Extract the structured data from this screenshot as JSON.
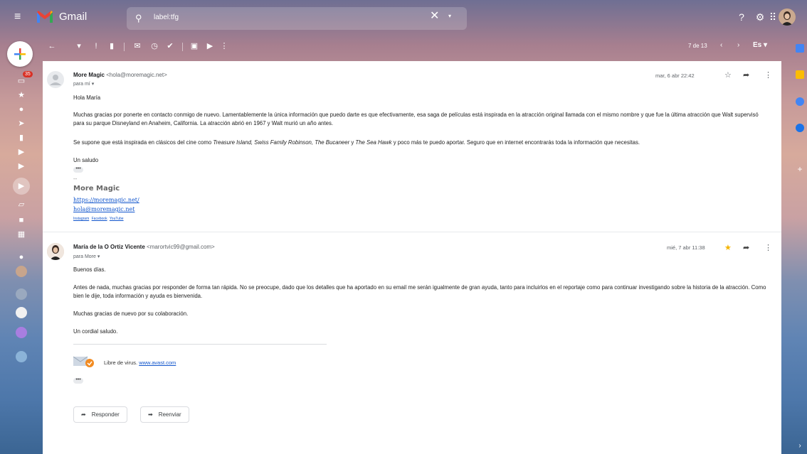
{
  "app": {
    "name": "Gmail",
    "search_query": "label:tfg",
    "unread_badge": "35",
    "pager": "7 de 13",
    "lang": "Es"
  },
  "messages": [
    {
      "sender_name": "More Magic",
      "sender_email": "<hola@moremagic.net>",
      "recipient": "para mí",
      "date": "mar, 6 abr 22:42",
      "greeting": "Hola María",
      "paragraph1": "Muchas gracias por ponerte en contacto conmigo de nuevo. Lamentablemente la única información que puedo darte es que efectivamente, esa saga de películas está inspirada en la atracción original llamada con el mismo nombre y que fue la última atracción que Walt supervisó para su parque Disneyland en Anaheim, California. La atracción abrió en 1967 y Walt murió un año antes.",
      "paragraph2_pre": "Se supone que está inspirada en clásicos del cine como ",
      "paragraph2_em1": "Treasure Island, Swiss Family Robinson, The Bucaneer",
      "paragraph2_mid": " y ",
      "paragraph2_em2": "The Sea Hawk",
      "paragraph2_post": " y poco más te puedo aportar. Seguro que en internet encontrarás toda la información que necesitas.",
      "closing": "Un saludo",
      "sig_dash": "--",
      "sig_name": "More Magic",
      "sig_url": "https://moremagic.net/",
      "sig_email": "hola@moremagic.net",
      "sig_social": [
        "Instagram",
        "Facebook",
        "YouTube"
      ],
      "starred": false
    },
    {
      "sender_name": "María de la O Ortiz Vicente",
      "sender_email": "<marortvic99@gmail.com>",
      "recipient": "para More",
      "date": "mié, 7 abr 11:38",
      "greeting": "Buenos días.",
      "paragraph1": "Antes de nada, muchas gracias por responder de forma tan rápida. No se preocupe, dado que los detalles que ha aportado en su email me serán igualmente de gran ayuda, tanto para incluirlos en el reportaje como para continuar investigando sobre la historia de la atracción. Como bien le dije, toda información y ayuda es bienvenida.",
      "paragraph2": "Muchas gracias de nuevo por su colaboración.",
      "closing": "Un cordial saludo.",
      "avast_label": "Libre de virus.",
      "avast_link": "www.avast.com",
      "starred": true
    }
  ],
  "actions": {
    "reply": "Responder",
    "forward": "Reenviar"
  },
  "colors": {
    "star_active": "#f4b400",
    "badge": "#d93025",
    "link": "#1155cc"
  }
}
